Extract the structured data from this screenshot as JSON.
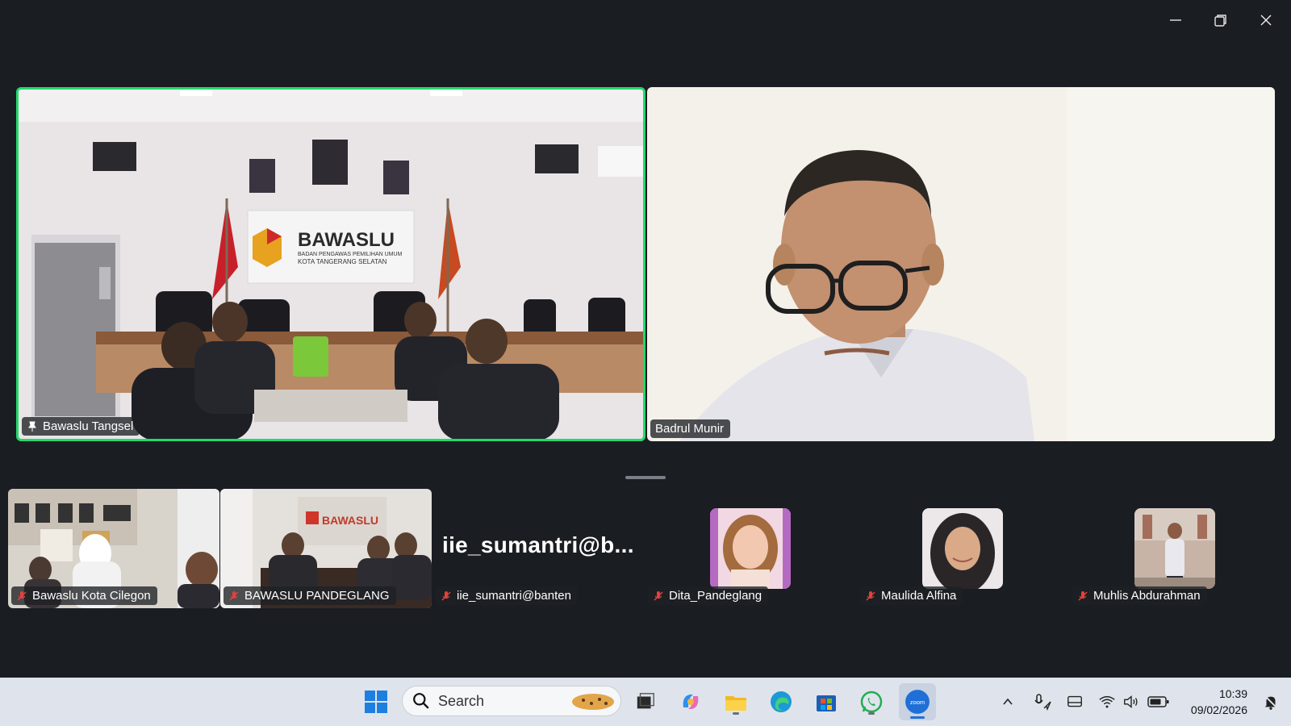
{
  "window": {
    "controls": [
      "minimize-icon",
      "restore-icon",
      "close-icon"
    ]
  },
  "stage": {
    "left_tile": {
      "name": "Bawaslu Tangsel",
      "pinned": true,
      "active_speaker": true,
      "banner_title": "BAWASLU",
      "banner_line1": "BADAN PENGAWAS PEMILIHAN UMUM",
      "banner_line2": "KOTA TANGERANG SELATAN"
    },
    "right_tile": {
      "name": "Badrul Munir"
    }
  },
  "strip": {
    "tiles": [
      {
        "name": "Bawaslu Kota Cilegon",
        "muted": true,
        "type": "video"
      },
      {
        "name": "BAWASLU PANDEGLANG",
        "muted": true,
        "type": "video",
        "banner": "BAWASLU"
      },
      {
        "name": "iie_sumantri@banten",
        "muted": true,
        "type": "text",
        "display": "iie_sumantri@b..."
      },
      {
        "name": "Dita_Pandeglang",
        "muted": true,
        "type": "photo"
      },
      {
        "name": "Maulida Alfina",
        "muted": true,
        "type": "photo"
      },
      {
        "name": "Muhlis Abdurahman",
        "muted": true,
        "type": "photo"
      }
    ]
  },
  "taskbar": {
    "search_placeholder": "Search",
    "apps": [
      "windows-start-icon",
      "search-icon",
      "task-view-icon",
      "copilot-icon",
      "file-explorer-icon",
      "edge-icon",
      "store-icon",
      "whatsapp-icon",
      "zoom-icon"
    ],
    "tray_icons": [
      "chevron-up-icon",
      "mic-location-icon",
      "display-icon",
      "wifi-icon",
      "volume-icon",
      "battery-icon",
      "notification-icon"
    ],
    "time": "10:39",
    "date": "09/02/2026"
  },
  "colors": {
    "background": "#1a1d22",
    "active_speaker_border": "#23d96b",
    "muted_red": "#e0423d",
    "taskbar": "#dfe4ec",
    "zoom_blue": "#1f6fd8"
  }
}
